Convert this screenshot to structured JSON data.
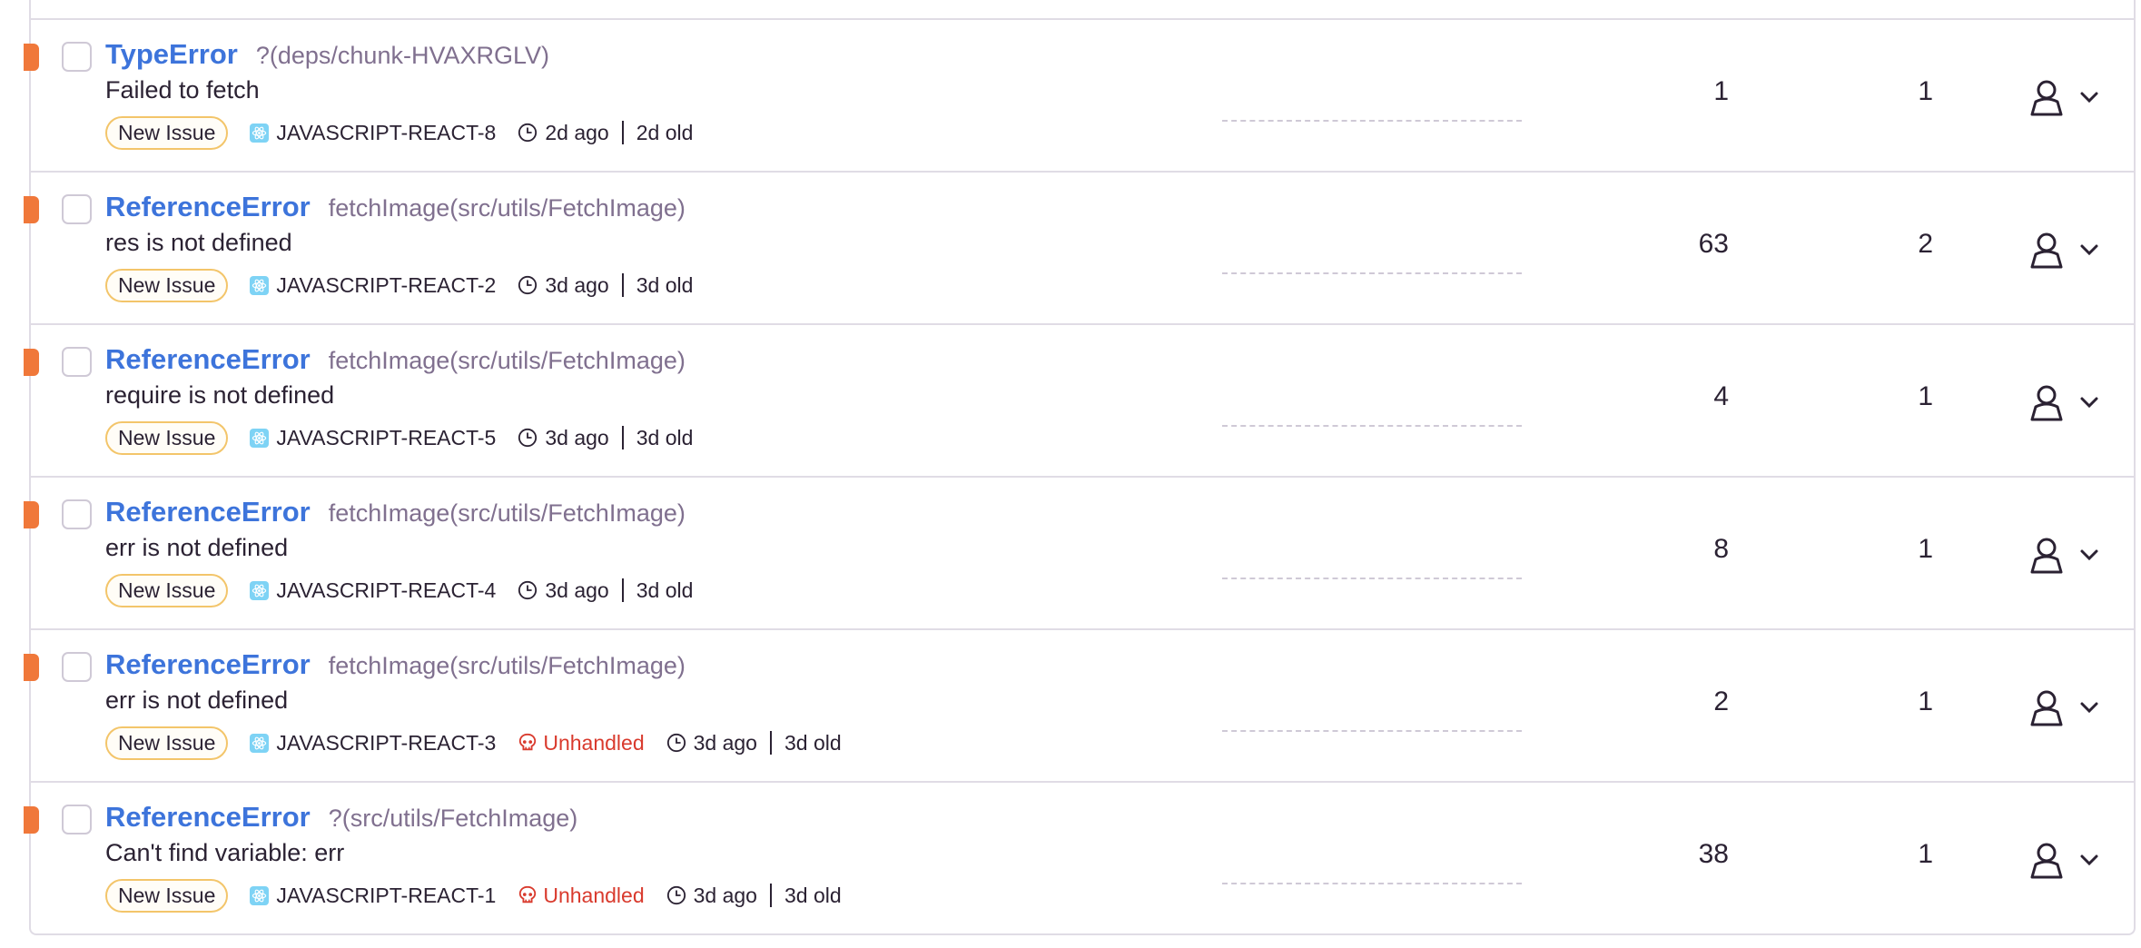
{
  "colors": {
    "level": "#f0783a",
    "link": "#3d74db",
    "badge_border": "#f3c56a",
    "unhandled": "#d93a2d",
    "border": "#e0dce5"
  },
  "issues": [
    {
      "type": "TypeError",
      "culprit": "?(deps/chunk-HVAXRGLV)",
      "message": "Failed to fetch",
      "badge": "New Issue",
      "project": "JAVASCRIPT-REACT-8",
      "unhandled": "",
      "last_seen": "2d ago",
      "age": "2d old",
      "events": "1",
      "users": "1"
    },
    {
      "type": "ReferenceError",
      "culprit": "fetchImage(src/utils/FetchImage)",
      "message": "res is not defined",
      "badge": "New Issue",
      "project": "JAVASCRIPT-REACT-2",
      "unhandled": "",
      "last_seen": "3d ago",
      "age": "3d old",
      "events": "63",
      "users": "2"
    },
    {
      "type": "ReferenceError",
      "culprit": "fetchImage(src/utils/FetchImage)",
      "message": "require is not defined",
      "badge": "New Issue",
      "project": "JAVASCRIPT-REACT-5",
      "unhandled": "",
      "last_seen": "3d ago",
      "age": "3d old",
      "events": "4",
      "users": "1"
    },
    {
      "type": "ReferenceError",
      "culprit": "fetchImage(src/utils/FetchImage)",
      "message": "err is not defined",
      "badge": "New Issue",
      "project": "JAVASCRIPT-REACT-4",
      "unhandled": "",
      "last_seen": "3d ago",
      "age": "3d old",
      "events": "8",
      "users": "1"
    },
    {
      "type": "ReferenceError",
      "culprit": "fetchImage(src/utils/FetchImage)",
      "message": "err is not defined",
      "badge": "New Issue",
      "project": "JAVASCRIPT-REACT-3",
      "unhandled": "Unhandled",
      "last_seen": "3d ago",
      "age": "3d old",
      "events": "2",
      "users": "1"
    },
    {
      "type": "ReferenceError",
      "culprit": "?(src/utils/FetchImage)",
      "message": "Can't find variable: err",
      "badge": "New Issue",
      "project": "JAVASCRIPT-REACT-1",
      "unhandled": "Unhandled",
      "last_seen": "3d ago",
      "age": "3d old",
      "events": "38",
      "users": "1"
    }
  ]
}
